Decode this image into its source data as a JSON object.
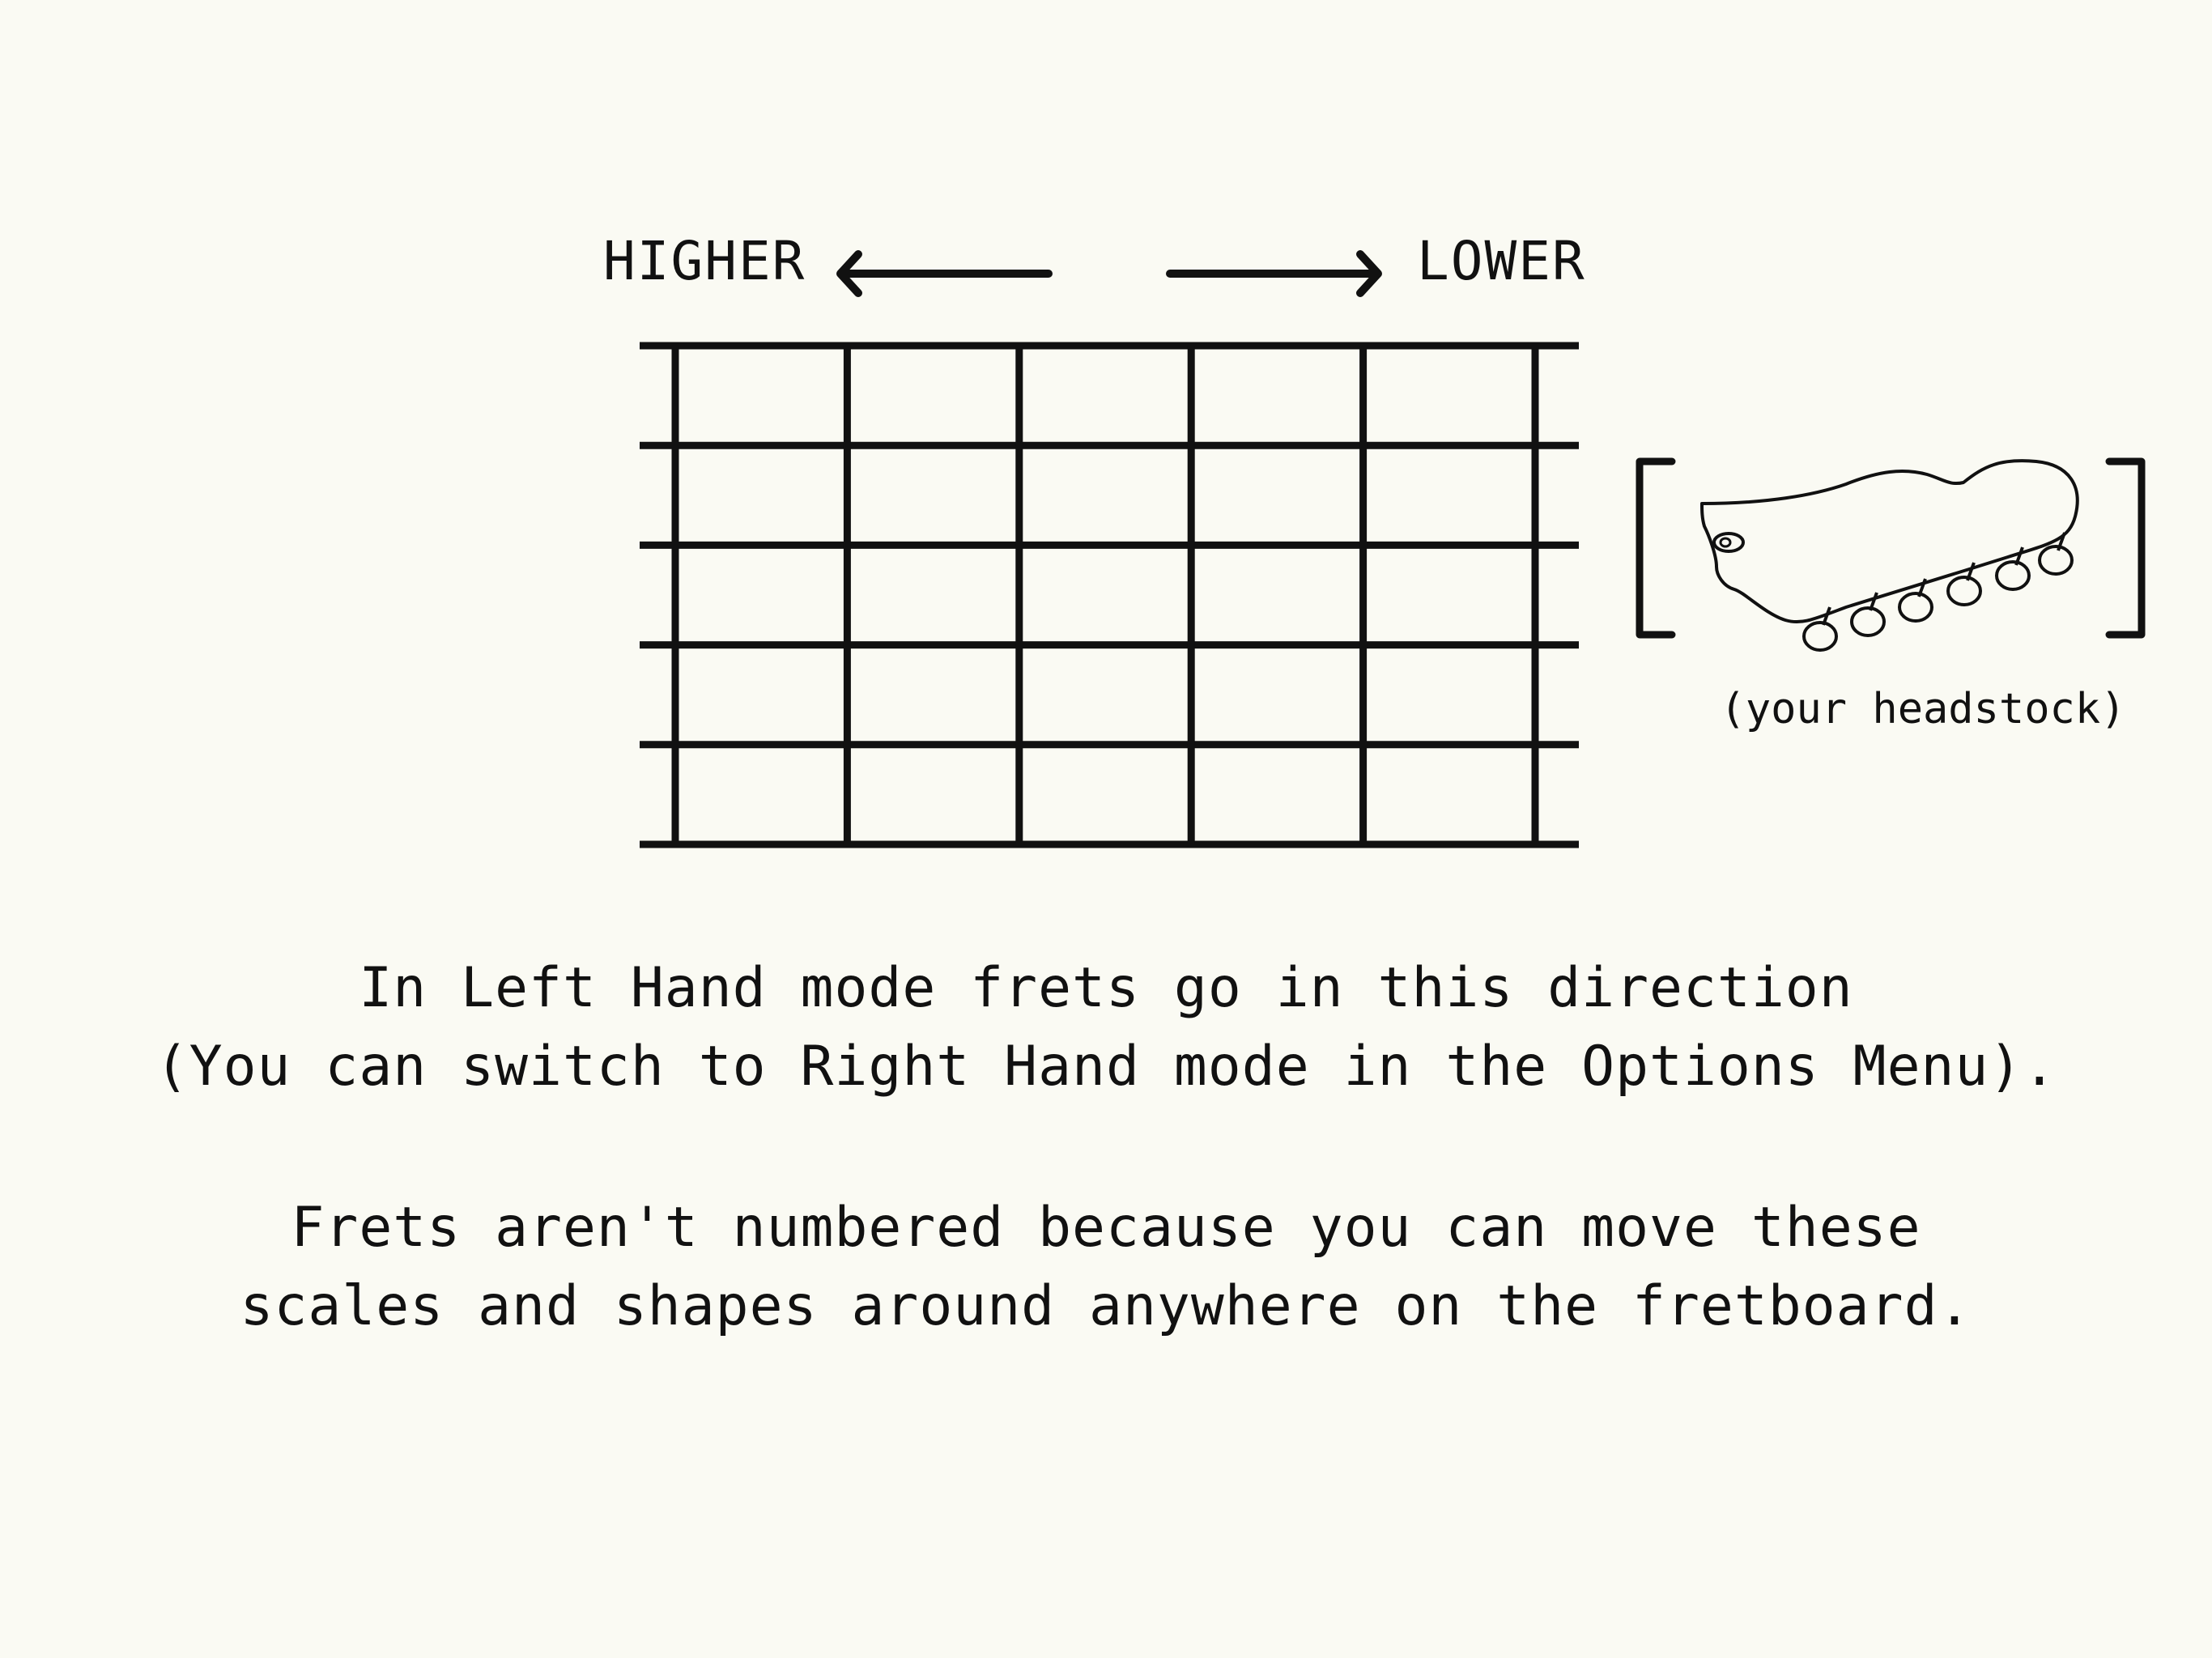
{
  "direction": {
    "higher": "HIGHER",
    "lower": "LOWER"
  },
  "fretboard": {
    "strings": 6,
    "fret_lines": 6
  },
  "headstock": {
    "caption": "(your headstock)",
    "icon": "guitar-headstock-icon"
  },
  "explanation": {
    "line1": "In Left Hand mode frets go in this direction",
    "line2": "(You can switch to Right Hand mode in the Options Menu)."
  },
  "frets_note": {
    "line1": "Frets aren't numbered because you can move these",
    "line2": "scales and shapes around anywhere on the fretboard."
  },
  "colors": {
    "background": "#fafaf3",
    "ink": "#111111"
  }
}
